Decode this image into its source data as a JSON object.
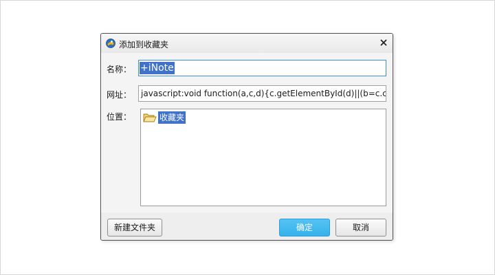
{
  "dialog": {
    "title": "添加到收藏夹",
    "app_icon": "browser-logo-icon",
    "close_icon": "close-icon"
  },
  "form": {
    "name_label": "名称：",
    "name_value": "+iNote",
    "url_label": "网址：",
    "url_value": "javascript:void function(a,c,d){c.getElementById(d)||(b=c.cr",
    "location_label": "位置："
  },
  "tree": {
    "items": [
      {
        "label": "收藏夹",
        "icon": "folder-open-icon",
        "selected": true
      }
    ]
  },
  "buttons": {
    "new_folder": "新建文件夹",
    "ok": "确定",
    "cancel": "取消"
  },
  "colors": {
    "selection": "#3f72c8",
    "primary_button": "#35b1ea",
    "focus_border": "#3a8fd6",
    "dialog_border": "#4d4d4d"
  }
}
